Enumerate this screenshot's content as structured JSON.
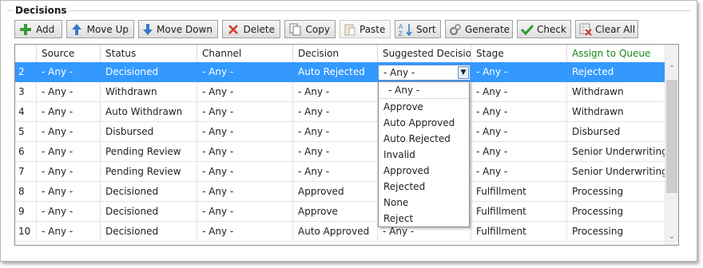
{
  "group_title": "Decisions",
  "toolbar": {
    "add": "Add",
    "move_up": "Move Up",
    "move_down": "Move Down",
    "delete": "Delete",
    "copy": "Copy",
    "paste": "Paste",
    "sort": "Sort",
    "generate": "Generate",
    "check": "Check",
    "clear_all": "Clear All"
  },
  "columns": [
    "",
    "Source",
    "Status",
    "Channel",
    "Decision",
    "Suggested Decision",
    "Stage",
    "Assign to Queue"
  ],
  "colors": {
    "selection": "#3399ff",
    "queue_header": "#1a8a1a",
    "accent_blue": "#3a78c8"
  },
  "rows": [
    [
      "2",
      "- Any -",
      "Decisioned",
      "- Any -",
      "Auto Rejected",
      "",
      "- Any -",
      "Rejected"
    ],
    [
      "3",
      "- Any -",
      "Withdrawn",
      "- Any -",
      "- Any -",
      "",
      "- Any -",
      "Withdrawn"
    ],
    [
      "4",
      "- Any -",
      "Auto Withdrawn",
      "- Any -",
      "- Any -",
      "",
      "- Any -",
      "Withdrawn"
    ],
    [
      "5",
      "- Any -",
      "Disbursed",
      "- Any -",
      "- Any -",
      "",
      "- Any -",
      "Disbursed"
    ],
    [
      "6",
      "- Any -",
      "Pending Review",
      "- Any -",
      "- Any -",
      "",
      "- Any -",
      "Senior Underwriting"
    ],
    [
      "7",
      "- Any -",
      "Pending Review",
      "- Any -",
      "- Any -",
      "",
      "- Any -",
      "Senior Underwriting"
    ],
    [
      "8",
      "- Any -",
      "Decisioned",
      "- Any -",
      "Approved",
      "",
      "Fulfillment",
      "Processing"
    ],
    [
      "9",
      "- Any -",
      "Decisioned",
      "- Any -",
      "Approve",
      "",
      "Fulfillment",
      "Processing"
    ],
    [
      "10",
      "- Any -",
      "Decisioned",
      "- Any -",
      "Auto Approved",
      "- Any -",
      "Fulfillment",
      "Processing"
    ]
  ],
  "dropdown": {
    "value": "- Any -",
    "options": [
      "- Any -",
      "Approve",
      "Auto Approved",
      "Auto Rejected",
      "Invalid",
      "Approved",
      "Rejected",
      "None",
      "Reject"
    ]
  }
}
